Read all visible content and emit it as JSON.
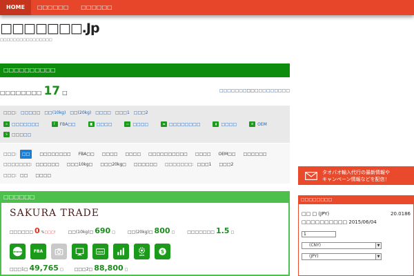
{
  "nav": {
    "home": "HOME",
    "item2": "□□□□□□",
    "item3": "□□□□□□"
  },
  "site": {
    "title": "□□□□□□□.Jp",
    "subtitle": "□□□□□□□□□□□□□□□□"
  },
  "list_section": {
    "heading": "□□□□□□□□□□",
    "count_label": "□□□□□□□□",
    "count_value": "17",
    "count_unit": "□",
    "link_blue_1": "□□□□□□□",
    "link_text": "□□",
    "link_blue_2": "□□□□□□□□□"
  },
  "sort": {
    "label": "□□□:",
    "options": [
      "□□□□□",
      "□□(10kg)",
      "□□(20kg)",
      "□□□□",
      "□□□1",
      "□□□2"
    ]
  },
  "features": [
    {
      "icon": "amazon-icon",
      "label": "□□□□□□□"
    },
    {
      "icon": "fba-icon",
      "label": "FBA□□"
    },
    {
      "icon": "camera-icon",
      "label": "□□□□"
    },
    {
      "icon": "monitor-icon",
      "label": "□□□□"
    },
    {
      "icon": "card-icon",
      "label": "□□□□□□□□"
    },
    {
      "icon": "chart-icon",
      "label": "□□□□"
    },
    {
      "icon": "oem-icon",
      "label": "OEM"
    },
    {
      "icon": "skype-icon",
      "label": "□□□□□"
    }
  ],
  "filters": {
    "row1_label": "□□□:",
    "row1_options": [
      "□□",
      "□□□□□□□□",
      "FBA□□",
      "□□□□",
      "□□□□",
      "□□□□□□□□□□",
      "□□□□",
      "OEM□□",
      "□□□□□□"
    ],
    "row2_label": "□□□□□□□:",
    "row2_options": [
      "□□□□□□",
      "□□□10kg□",
      "□□□20kg□",
      "□□□□□□"
    ],
    "row2b_label": "□□□□□□□:",
    "row2b_options": [
      "□□□1",
      "□□□2"
    ],
    "row3_label": "□□□:",
    "row3_options": [
      "□□",
      "□□□□"
    ]
  },
  "shop_section": {
    "heading": "□□□□□□",
    "shop_name": "SAKURA TRADE",
    "fee_label": "□□□□□□",
    "fee_value": "0",
    "fee_unit": "%",
    "fee_free": "□□□!",
    "ship10_label": "□□(10kg)□",
    "ship10_value": "690",
    "ship10_unit": "□",
    "ship20_label": "□□(20kg)□",
    "ship20_value": "800",
    "ship20_unit": "□",
    "rate_label": "□□□□□□□",
    "rate_value": "1.5",
    "rate_unit": "□",
    "service_icons": [
      {
        "icon": "amazon-icon",
        "text": "amazon",
        "gray": false
      },
      {
        "icon": "fba-icon",
        "text": "FBA",
        "gray": false
      },
      {
        "icon": "camera-icon",
        "text": "",
        "gray": true
      },
      {
        "icon": "monitor-icon",
        "text": "",
        "gray": false
      },
      {
        "icon": "card-icon",
        "text": "CARD",
        "gray": false
      },
      {
        "icon": "chart-icon",
        "text": "",
        "gray": false
      },
      {
        "icon": "oem-icon",
        "text": "OEM",
        "gray": false
      },
      {
        "icon": "skype-icon",
        "text": "S",
        "gray": false
      }
    ],
    "price1_label": "□□□1□",
    "price1_value": "49,765",
    "price1_unit": "□",
    "price2_label": "□□□2□",
    "price2_value": "88,800",
    "price2_unit": "□"
  },
  "sidebar": {
    "promo_line1": "タオバオ輸入代行の最新情報や",
    "promo_line2": "キャンペーン情報などを配信！",
    "rate_heading": "□□□□□□□□",
    "rate_pair": "□□ □ (JPY)",
    "rate_value": "20.0186",
    "rate_date_label": "□□□□□□□□□□",
    "rate_date": "2015/06/04",
    "amount_value": "1",
    "from_currency": "(CNY)",
    "to_currency": "(JPY)"
  },
  "colors": {
    "nav_red": "#e8462a",
    "green_dark": "#0d8c0d",
    "green_light": "#4cbf4c",
    "link_blue": "#1a5fb4",
    "number_green": "#1c8b1c",
    "number_red": "#e62e1a"
  }
}
